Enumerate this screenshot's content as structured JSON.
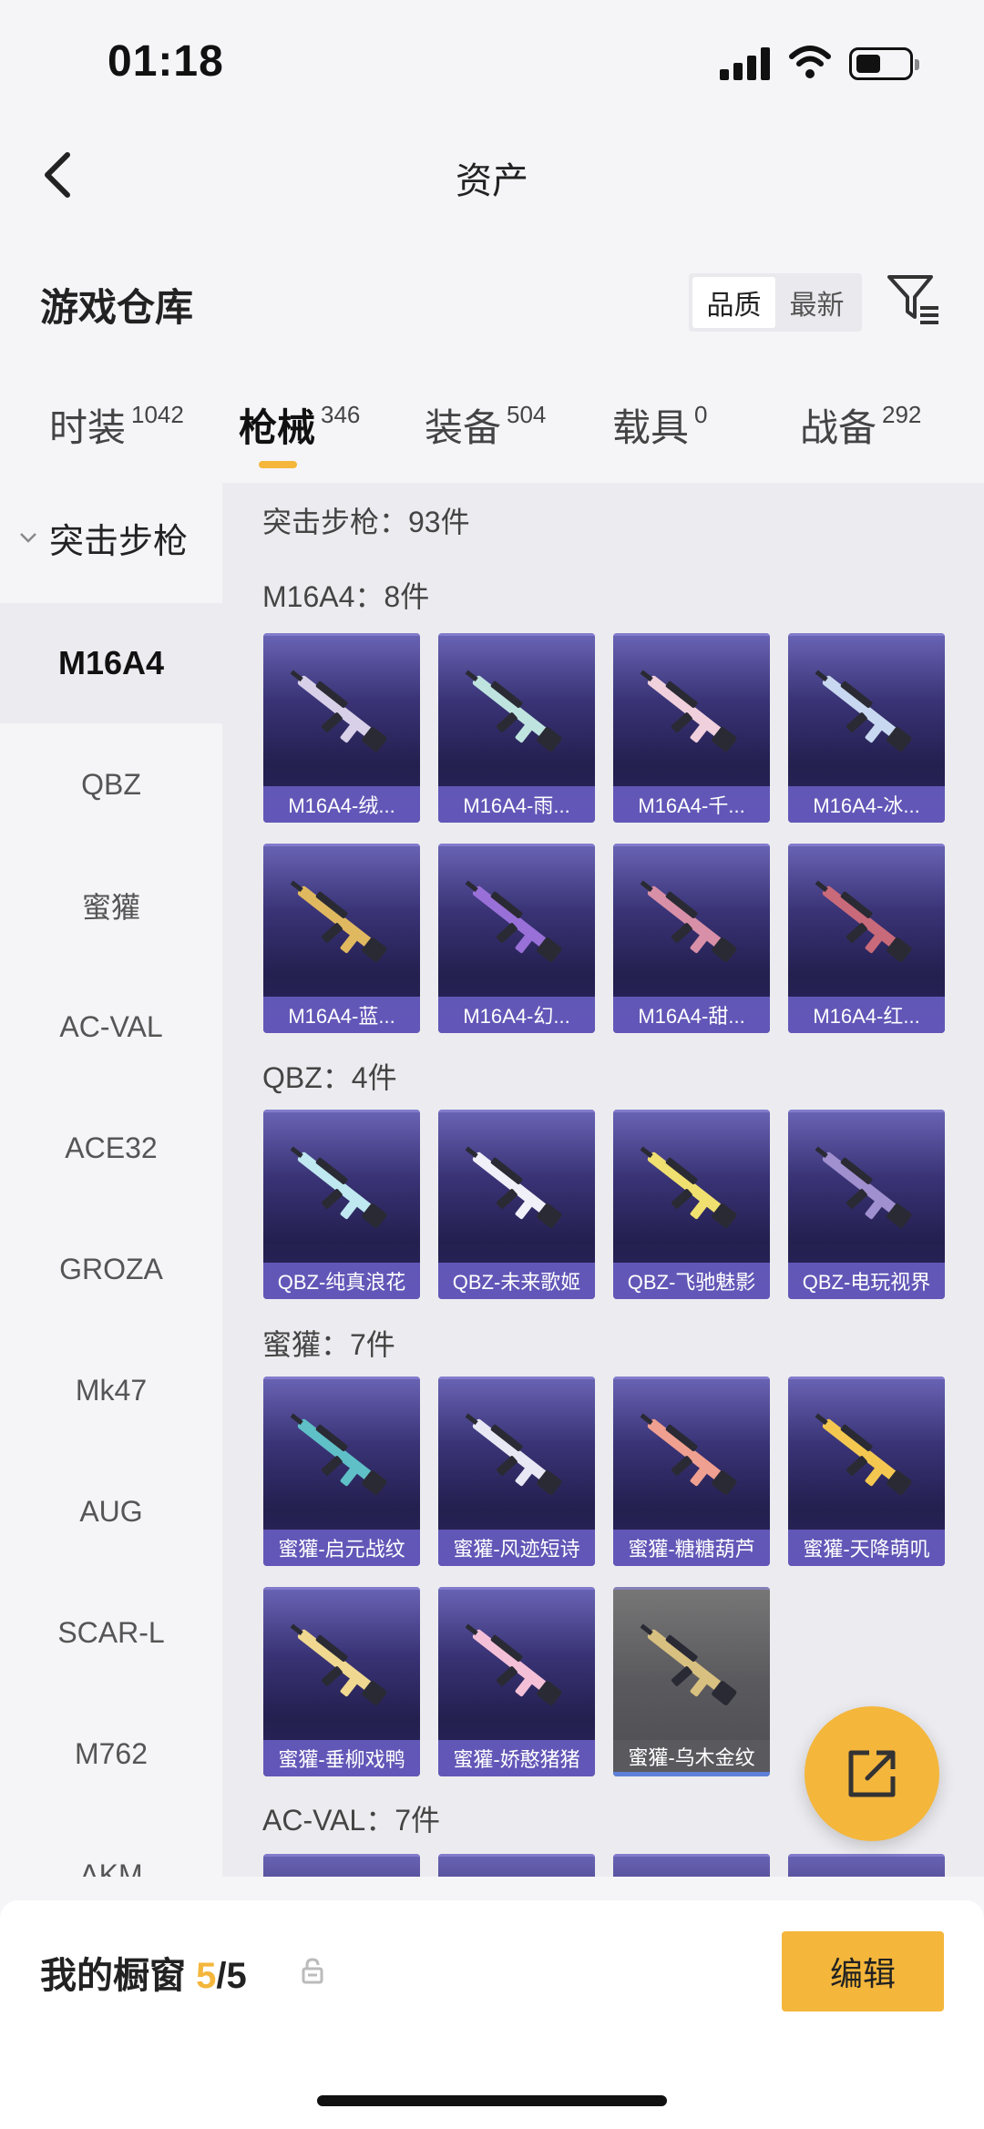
{
  "status": {
    "time": "01:18"
  },
  "nav": {
    "title": "资产"
  },
  "header": {
    "title": "游戏仓库",
    "sort_options": [
      "品质",
      "最新"
    ],
    "sort_selected": "品质"
  },
  "tabs": [
    {
      "label": "时装",
      "count": "1042"
    },
    {
      "label": "枪械",
      "count": "346",
      "active": true
    },
    {
      "label": "装备",
      "count": "504"
    },
    {
      "label": "载具",
      "count": "0"
    },
    {
      "label": "战备",
      "count": "292"
    }
  ],
  "sidebar": {
    "category": "突击步枪",
    "items": [
      "M16A4",
      "QBZ",
      "蜜獾",
      "AC-VAL",
      "ACE32",
      "GROZA",
      "Mk47",
      "AUG",
      "SCAR-L",
      "M762",
      "AKM"
    ],
    "active": "M16A4"
  },
  "content": {
    "summary": "突击步枪：93件",
    "sections": [
      {
        "title": "M16A4：8件",
        "items": [
          "M16A4-绒...",
          "M16A4-雨...",
          "M16A4-千...",
          "M16A4-冰...",
          "M16A4-蓝...",
          "M16A4-幻...",
          "M16A4-甜...",
          "M16A4-红..."
        ]
      },
      {
        "title": "QBZ：4件",
        "items": [
          "QBZ-纯真浪花",
          "QBZ-未来歌姬",
          "QBZ-飞驰魅影",
          "QBZ-电玩视界"
        ]
      },
      {
        "title": "蜜獾：7件",
        "items": [
          "蜜獾-启元战纹",
          "蜜獾-风迹短诗",
          "蜜獾-糖糖葫芦",
          "蜜獾-天降萌叽",
          "蜜獾-垂柳戏鸭",
          "蜜獾-娇憨猪猪",
          "蜜獾-乌木金纹"
        ]
      },
      {
        "title": "AC-VAL：7件",
        "items": []
      }
    ]
  },
  "showcase": {
    "title": "我的橱窗",
    "current": "5",
    "total": "/5",
    "edit_label": "编辑"
  },
  "colors": {
    "accent": "#f4b63b",
    "card_purple": "#3a3477"
  }
}
